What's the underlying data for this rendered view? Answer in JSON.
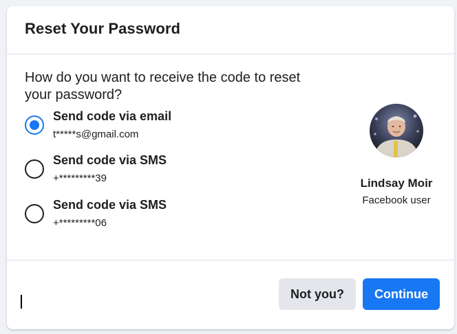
{
  "dialog": {
    "title": "Reset Your Password",
    "question": "How do you want to receive the code to reset your password?"
  },
  "options": [
    {
      "label": "Send code via email",
      "detail": "t*****s@gmail.com",
      "selected": true
    },
    {
      "label": "Send code via SMS",
      "detail": "+*********39",
      "selected": false
    },
    {
      "label": "Send code via SMS",
      "detail": "+*********06",
      "selected": false
    }
  ],
  "profile": {
    "name": "Lindsay Moir",
    "subtitle": "Facebook user"
  },
  "footer": {
    "not_you_label": "Not you?",
    "continue_label": "Continue"
  },
  "colors": {
    "accent": "#1877f2",
    "secondary_button": "#e4e6eb",
    "divider": "#dddfe2",
    "page_background": "#f0f2f5"
  }
}
